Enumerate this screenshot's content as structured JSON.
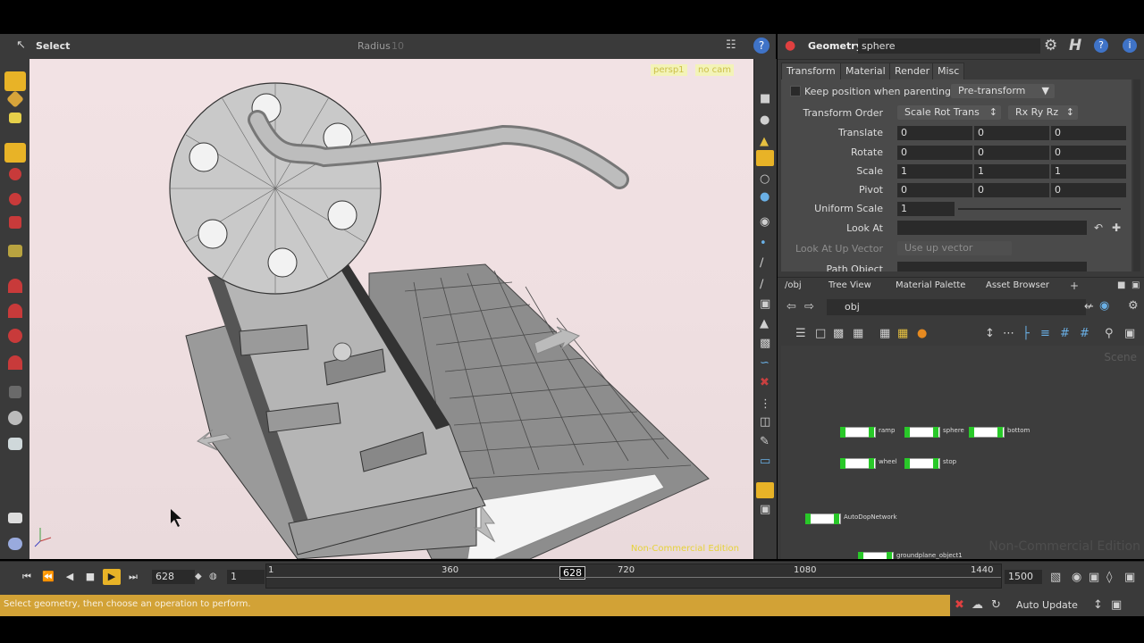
{
  "viewport": {
    "tool_label": "Select",
    "radius_label": "Radius",
    "radius_value": "10",
    "camera_labels": [
      "persp1",
      "no cam"
    ],
    "watermark": "Non-Commercial Edition"
  },
  "parameters": {
    "node_type": "Geometry",
    "node_name": "sphere",
    "tabs": [
      "Transform",
      "Material",
      "Render",
      "Misc"
    ],
    "keep_position_label": "Keep position when parenting",
    "keep_position_menu": "Pre-transform",
    "transform_order_label": "Transform Order",
    "transform_order_value": "Scale Rot Trans",
    "rotate_order_value": "Rx Ry Rz",
    "translate_label": "Translate",
    "translate": [
      "0",
      "0",
      "0"
    ],
    "rotate_label": "Rotate",
    "rotate": [
      "0",
      "0",
      "0"
    ],
    "scale_label": "Scale",
    "scale": [
      "1",
      "1",
      "1"
    ],
    "pivot_label": "Pivot",
    "pivot": [
      "0",
      "0",
      "0"
    ],
    "uniform_scale_label": "Uniform Scale",
    "uniform_scale": "1",
    "look_at_label": "Look At",
    "look_at_up_label": "Look At Up Vector",
    "look_at_up_value": "Use up vector",
    "path_object_label": "Path Object"
  },
  "network": {
    "tabs": [
      "/obj",
      "Tree View",
      "Material Palette",
      "Asset Browser"
    ],
    "path": "obj",
    "scene_label": "Scene",
    "watermark": "Non-Commercial Edition",
    "nodes": [
      {
        "label": "ramp"
      },
      {
        "label": "sphere"
      },
      {
        "label": "bottom"
      },
      {
        "label": "wheel"
      },
      {
        "label": "stop"
      },
      {
        "label": "AutoDopNetwork"
      },
      {
        "label": "groundplane_object1"
      }
    ]
  },
  "timeline": {
    "current_frame": "628",
    "start_frame": "1",
    "end_frame": "1500",
    "ruler_labels": [
      "1",
      "360",
      "720",
      "1080",
      "1440"
    ],
    "ruler_current": "628"
  },
  "status": {
    "message": "Select geometry, then choose an operation to perform.",
    "auto_update": "Auto Update"
  },
  "colors": {
    "accent": "#e8b327",
    "status_bar": "#d2a236",
    "panel_bg": "#3a3a3a",
    "node_flag": "#29c829"
  }
}
